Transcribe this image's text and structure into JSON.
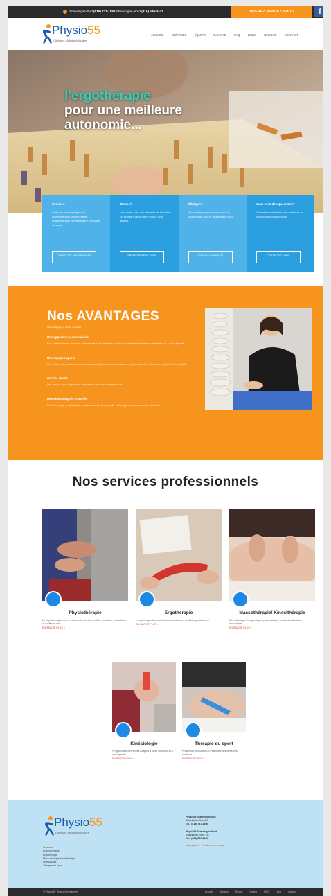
{
  "topbar": {
    "phone1_label": "Shawinigan-Sud",
    "phone1": "(819) 731-1896",
    "phone2_label": "Shawinigan-Nord",
    "phone2": "(819) 539-4442",
    "cta": "PRENEZ RENDEZ-VOUS",
    "fb": "f"
  },
  "brand": {
    "name_word": "Physio",
    "name_num": "55",
    "tagline": "Cliniques Multidisciplinaires"
  },
  "nav": [
    "Accueil",
    "Services",
    "Équipe",
    "Galerie",
    "FAQ",
    "Liens",
    "Blogue",
    "Contact"
  ],
  "hero": {
    "line1": "l'ergothérapie",
    "line2": "pour une meilleure",
    "line3": "autonomie..."
  },
  "features": [
    {
      "title": "Services",
      "text": "Soins de première ligne en physiothérapie, ergothérapie, massothérapie, kinésiologie et thérapie du sport.",
      "button": "CONSULTEZ NOS SERVICES",
      "color": "#4fb3ea"
    },
    {
      "title": "Blessé?",
      "text": "Vous avez subi une blessure de travail ou un accident de la route? Nous vous aidons.",
      "button": "PRENEZ RENDEZ-VOUS",
      "color": "#2b9fe0"
    },
    {
      "title": "Cliniques",
      "text": "Deux cliniques pour vous servir à Shawinigan-Sud et Shawinigan-Nord.",
      "button": "VOIR NOS CLINIQUES",
      "color": "#4fb3ea"
    },
    {
      "title": "Vous avez des questions?",
      "text": "Consultez notre foire aux questions ou communiquez avec nous.",
      "button": "CONTACTEZ-NOUS",
      "color": "#2b9fe0"
    }
  ],
  "advantages": {
    "title": "Nos AVANTAGES",
    "subtitle": "Une équipe à votre écoute",
    "blocks": [
      {
        "title": "Une approche personnalisée",
        "text": "Nos professionnels évaluent votre condition et élaborent un plan de traitement adapté à vos besoins et à vos objectifs."
      },
      {
        "title": "Une équipe experte",
        "text": "Une équipe de professionnels dévoués et expérimentés qui collaborent pour vous offrir des soins complets et de qualité."
      },
      {
        "title": "Service rapide",
        "text": "Des rendez-vous disponibles rapidement, de jour comme de soir."
      },
      {
        "title": "Des soins adaptés et variés",
        "text": "Physiothérapie, ergothérapie, massothérapie, kinésiologie et thérapie du sport sous un même toit."
      }
    ]
  },
  "services": {
    "title": "Nos services professionnels",
    "read_more": "EN SAVOIR PLUS »",
    "items": [
      {
        "name": "Physiothérapie",
        "text": "La physiothérapie vise à restaurer la fonction, réduire la douleur et améliorer la qualité de vie."
      },
      {
        "name": "Ergothérapie",
        "text": "L'ergothérapie favorise l'autonomie dans les activités quotidiennes."
      },
      {
        "name": "Massothérapie/ Kinésithérapie",
        "text": "Des massages thérapeutiques pour soulager tensions et douleurs musculaires."
      },
      {
        "name": "Kinésiologie",
        "text": "Programmes d'exercices adaptés à votre condition et à vos objectifs."
      },
      {
        "name": "Thérapie du sport",
        "text": "Prévention, évaluation et traitement des blessures sportives."
      }
    ]
  },
  "footer": {
    "menu_title": "Services",
    "menu": [
      "Physiothérapie",
      "Ergothérapie",
      "Massothérapie/Kinésithérapie",
      "Kinésiologie",
      "Thérapie du sport"
    ],
    "clinic1_name": "Physio55 Shawinigan-Sud",
    "clinic1_addr": "Shawinigan-Sud, QC",
    "clinic1_tel": "Tél.: (819) 731-1896",
    "clinic2_name": "Physio55 Shawinigan-Nord",
    "clinic2_addr": "Shawinigan-Nord, QC",
    "clinic2_tel": "Tél.: (819) 539-4442",
    "links": "Nous joindre · Prendre rendez-vous"
  },
  "copyright": {
    "left": "© Physio55 · Tous droits réservés",
    "right": [
      "Accueil",
      "Services",
      "Équipe",
      "Galerie",
      "FAQ",
      "Liens",
      "Contact"
    ]
  }
}
